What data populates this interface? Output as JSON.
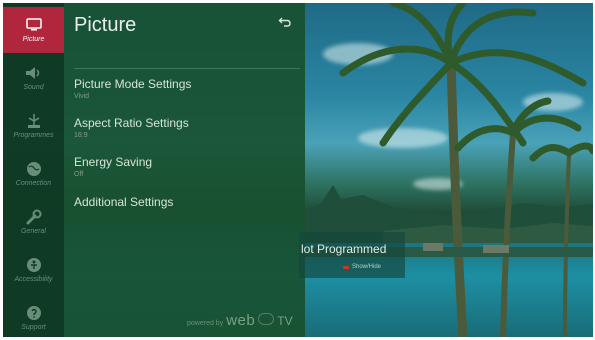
{
  "sidebar": {
    "items": [
      {
        "label": "Picture",
        "icon": "picture-icon",
        "active": true
      },
      {
        "label": "Sound",
        "icon": "speaker-icon",
        "active": false
      },
      {
        "label": "Programmes",
        "icon": "antenna-icon",
        "active": false
      },
      {
        "label": "Connection",
        "icon": "globe-icon",
        "active": false
      },
      {
        "label": "General",
        "icon": "wrench-icon",
        "active": false
      },
      {
        "label": "Accessibility",
        "icon": "accessibility-icon",
        "active": false
      },
      {
        "label": "Support",
        "icon": "support-icon",
        "active": false
      }
    ]
  },
  "panel": {
    "title": "Picture",
    "back_icon": "back-arrow-icon",
    "items": [
      {
        "label": "Picture Mode Settings",
        "value": "Vivid"
      },
      {
        "label": "Aspect Ratio Settings",
        "value": "16:9"
      },
      {
        "label": "Energy Saving",
        "value": "Off"
      },
      {
        "label": "Additional Settings",
        "value": ""
      }
    ],
    "powered_by": "powered by",
    "brand": "web",
    "brand_suffix": "TV"
  },
  "overlay": {
    "title": "lot Programmed",
    "hint": "Show/Hide"
  },
  "colors": {
    "active_tab": "#b3263c",
    "panel_bg": "#185030",
    "rail_bg": "#0f3a24"
  }
}
